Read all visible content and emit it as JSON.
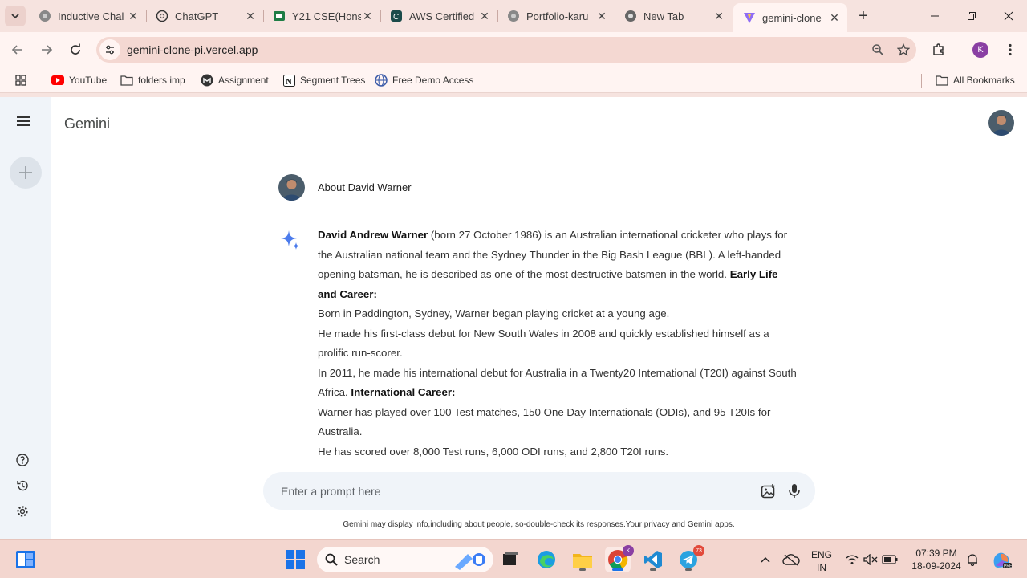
{
  "browser": {
    "tabs": [
      {
        "title": "Inductive Chal",
        "icon": "globe-icon"
      },
      {
        "title": "ChatGPT",
        "icon": "chatgpt-icon"
      },
      {
        "title": "Y21 CSE(Hons",
        "icon": "sheets-icon"
      },
      {
        "title": "AWS Certified",
        "icon": "coursera-icon"
      },
      {
        "title": "Portfolio-karu",
        "icon": "globe-icon"
      },
      {
        "title": "New Tab",
        "icon": "chrome-icon"
      },
      {
        "title": "gemini-clone",
        "icon": "vite-icon",
        "active": true
      }
    ],
    "url": "gemini-clone-pi.vercel.app",
    "profile_initial": "K",
    "bookmarks": [
      {
        "label": "YouTube",
        "icon": "youtube-icon"
      },
      {
        "label": "folders imp",
        "icon": "folder-icon"
      },
      {
        "label": "Assignment",
        "icon": "assignment-icon"
      },
      {
        "label": "Segment Trees",
        "icon": "notion-icon"
      },
      {
        "label": "Free Demo Access",
        "icon": "globe-icon"
      }
    ],
    "all_bookmarks_label": "All Bookmarks"
  },
  "app": {
    "brand": "Gemini",
    "user_prompt": "About David Warner",
    "answer": {
      "p1_bold": "David Andrew Warner",
      "p1_text": " (born 27 October 1986) is an Australian international cricketer who plays for the Australian national team and the Sydney Thunder in the Big Bash League (BBL). A left-handed opening batsman, he is described as one of the most destructive batsmen in the world. ",
      "h1": "Early Life and Career:",
      "l1": "Born in Paddington, Sydney, Warner began playing cricket at a young age.",
      "l2": "He made his first-class debut for New South Wales in 2008 and quickly established himself as a prolific run-scorer.",
      "l3": "In 2011, he made his international debut for Australia in a Twenty20 International (T20I) against South Africa. ",
      "h2": "International Career:",
      "l4": "Warner has played over 100 Test matches, 150 One Day Internationals (ODIs), and 95 T20Is for Australia.",
      "l5": "He has scored over 8,000 Test runs, 6,000 ODI runs, and 2,800 T20I runs."
    },
    "prompt_placeholder": "Enter a prompt here",
    "disclaimer": "Gemini may display info,including about people, so-double-check its responses.Your privacy and Gemini apps."
  },
  "taskbar": {
    "search_label": "Search",
    "lang_line1": "ENG",
    "lang_line2": "IN",
    "time": "07:39 PM",
    "date": "18-09-2024",
    "telegram_badge": "73"
  },
  "colors": {
    "chrome_frame": "#f6e3df",
    "toolbar": "#fff4f2",
    "sidebar": "#f0f4f9",
    "accent_blue": "#4b7bec"
  }
}
